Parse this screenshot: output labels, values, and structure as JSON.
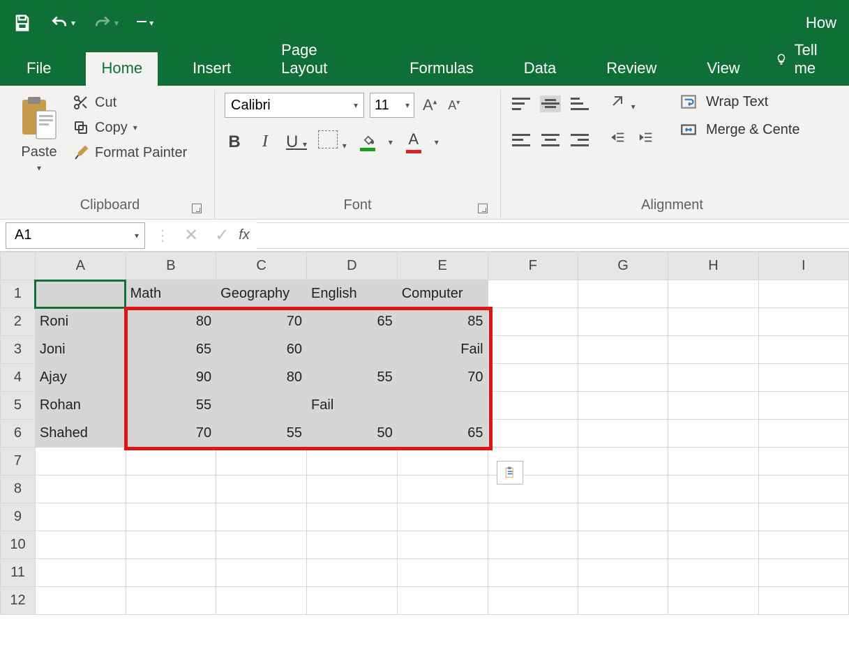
{
  "titlebar": {
    "title_fragment": "How"
  },
  "tabs": {
    "file": "File",
    "home": "Home",
    "insert": "Insert",
    "page_layout": "Page Layout",
    "formulas": "Formulas",
    "data": "Data",
    "review": "Review",
    "view": "View",
    "tell_me": "Tell me"
  },
  "clipboard": {
    "paste": "Paste",
    "cut": "Cut",
    "copy": "Copy",
    "format_painter": "Format Painter",
    "group_label": "Clipboard"
  },
  "font": {
    "name": "Calibri",
    "size": "11",
    "group_label": "Font"
  },
  "alignment": {
    "wrap_text": "Wrap Text",
    "merge_center": "Merge & Cente",
    "group_label": "Alignment"
  },
  "namebox": {
    "value": "A1"
  },
  "formula_bar": {
    "fx": "fx",
    "value": ""
  },
  "grid": {
    "columns": [
      "A",
      "B",
      "C",
      "D",
      "E",
      "F",
      "G",
      "H",
      "I"
    ],
    "rows": [
      "1",
      "2",
      "3",
      "4",
      "5",
      "6",
      "7",
      "8",
      "9",
      "10",
      "11",
      "12"
    ],
    "headers": {
      "B1": "Math",
      "C1": "Geography",
      "D1": "English",
      "E1": "Computer"
    },
    "names": {
      "A2": "Roni",
      "A3": "Joni",
      "A4": "Ajay",
      "A5": "Rohan",
      "A6": "Shahed"
    },
    "data": {
      "B2": "80",
      "C2": "70",
      "D2": "65",
      "E2": "85",
      "B3": "65",
      "C3": "60",
      "D3": "",
      "E3": "Fail",
      "B4": "90",
      "C4": "80",
      "D4": "55",
      "E4": "70",
      "B5": "55",
      "C5": "",
      "D5": "Fail",
      "E5": "",
      "B6": "70",
      "C6": "55",
      "D6": "50",
      "E6": "65"
    }
  }
}
